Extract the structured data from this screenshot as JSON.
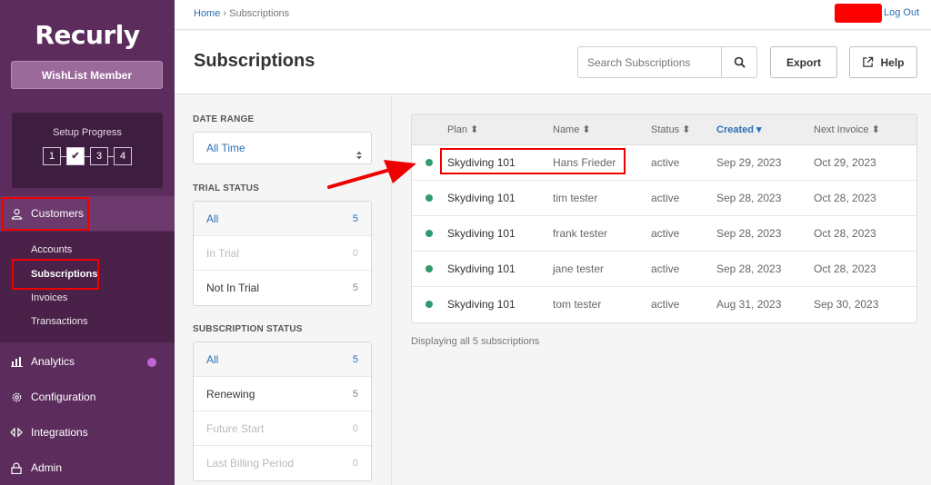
{
  "brand": {
    "logo": "Recurly",
    "site_button": "WishList Member"
  },
  "setup": {
    "title": "Setup Progress",
    "steps": [
      "1",
      "✔",
      "3",
      "4"
    ]
  },
  "nav": {
    "customers": "Customers",
    "sub": [
      "Accounts",
      "Subscriptions",
      "Invoices",
      "Transactions"
    ],
    "analytics": "Analytics",
    "configuration": "Configuration",
    "integrations": "Integrations",
    "admin": "Admin"
  },
  "topbar": {
    "home": "Home",
    "sep": "›",
    "current": "Subscriptions",
    "logout": "Log Out"
  },
  "header": {
    "title": "Subscriptions",
    "search_placeholder": "Search Subscriptions",
    "export": "Export",
    "help": "Help"
  },
  "filters": {
    "date_range_label": "DATE RANGE",
    "date_range_value": "All Time",
    "trial_label": "TRIAL STATUS",
    "trial": [
      {
        "label": "All",
        "count": "5"
      },
      {
        "label": "In Trial",
        "count": "0"
      },
      {
        "label": "Not In Trial",
        "count": "5"
      }
    ],
    "sub_status_label": "SUBSCRIPTION STATUS",
    "sub_status": [
      {
        "label": "All",
        "count": "5"
      },
      {
        "label": "Renewing",
        "count": "5"
      },
      {
        "label": "Future Start",
        "count": "0"
      },
      {
        "label": "Last Billing Period",
        "count": "0"
      }
    ]
  },
  "table": {
    "columns": [
      "Plan ⬍",
      "Name ⬍",
      "Status ⬍",
      "Created ▾",
      "Next Invoice ⬍"
    ],
    "rows": [
      {
        "plan": "Skydiving 101",
        "name": "Hans Frieder",
        "status": "active",
        "created": "Sep 29, 2023",
        "next": "Oct 29, 2023"
      },
      {
        "plan": "Skydiving 101",
        "name": "tim tester",
        "status": "active",
        "created": "Sep 28, 2023",
        "next": "Oct 28, 2023"
      },
      {
        "plan": "Skydiving 101",
        "name": "frank tester",
        "status": "active",
        "created": "Sep 28, 2023",
        "next": "Oct 28, 2023"
      },
      {
        "plan": "Skydiving 101",
        "name": "jane tester",
        "status": "active",
        "created": "Sep 28, 2023",
        "next": "Oct 28, 2023"
      },
      {
        "plan": "Skydiving 101",
        "name": "tom tester",
        "status": "active",
        "created": "Aug 31, 2023",
        "next": "Sep 30, 2023"
      }
    ],
    "footer": "Displaying all 5 subscriptions"
  },
  "colors": {
    "sidebar": "#5c2d5c",
    "accent": "#2c6fb3",
    "status_active": "#2f9a6e",
    "highlight": "#ee0000"
  }
}
